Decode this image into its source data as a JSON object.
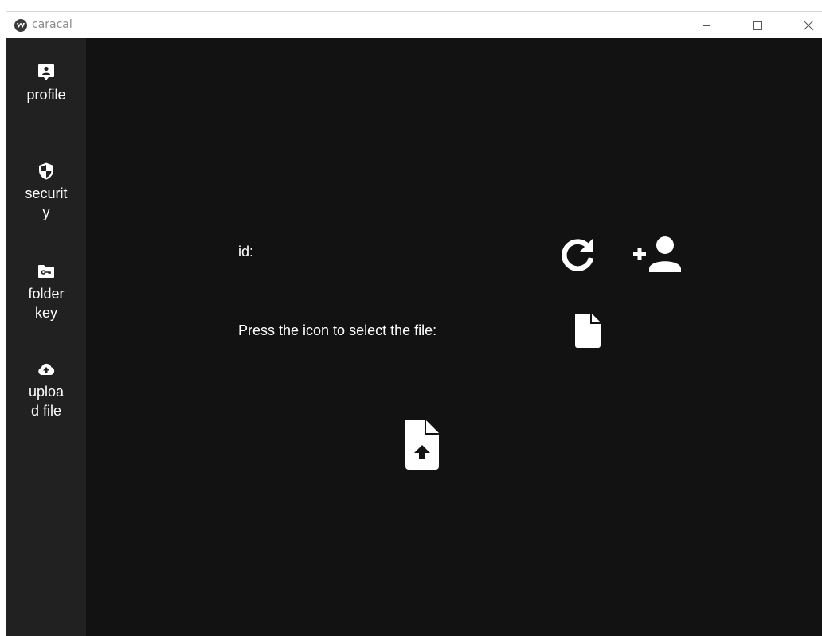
{
  "window": {
    "title": "caracal"
  },
  "sidebar": {
    "items": [
      {
        "label": "profile",
        "icon": "profile-icon"
      },
      {
        "label": "security",
        "icon": "shield-icon"
      },
      {
        "label": "folder key",
        "icon": "folder-key-icon"
      },
      {
        "label": "upload file",
        "icon": "cloud-upload-icon"
      }
    ]
  },
  "main": {
    "id_label": "id:",
    "file_prompt": "Press the icon to select the file:",
    "icons": {
      "refresh": "refresh-icon",
      "add_user": "add-user-icon",
      "file": "file-icon",
      "file_upload": "file-upload-icon"
    }
  },
  "colors": {
    "sidebar_bg": "#212121",
    "main_bg": "#121212",
    "text": "#ffffff"
  }
}
